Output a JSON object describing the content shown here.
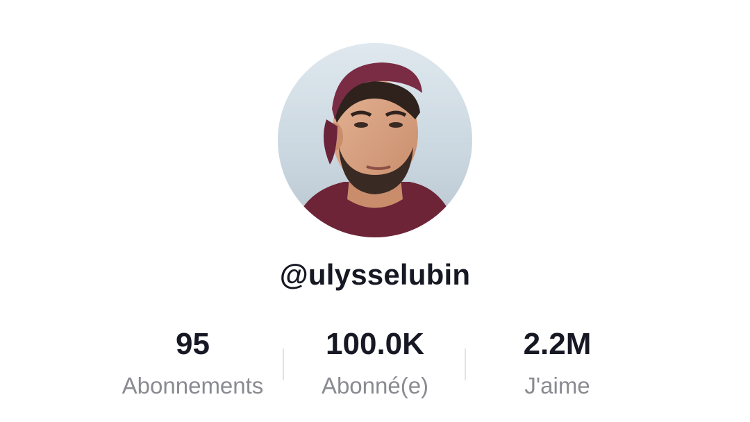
{
  "profile": {
    "username": "@ulysselubin",
    "avatar_icon": "profile-photo",
    "stats": {
      "following": {
        "count": "95",
        "label": "Abonnements"
      },
      "followers": {
        "count": "100.0K",
        "label": "Abonné(e)"
      },
      "likes": {
        "count": "2.2M",
        "label": "J'aime"
      }
    }
  },
  "colors": {
    "text_primary": "#161823",
    "text_secondary": "#8a8b91",
    "divider": "#e3e3e4",
    "background": "#ffffff"
  }
}
